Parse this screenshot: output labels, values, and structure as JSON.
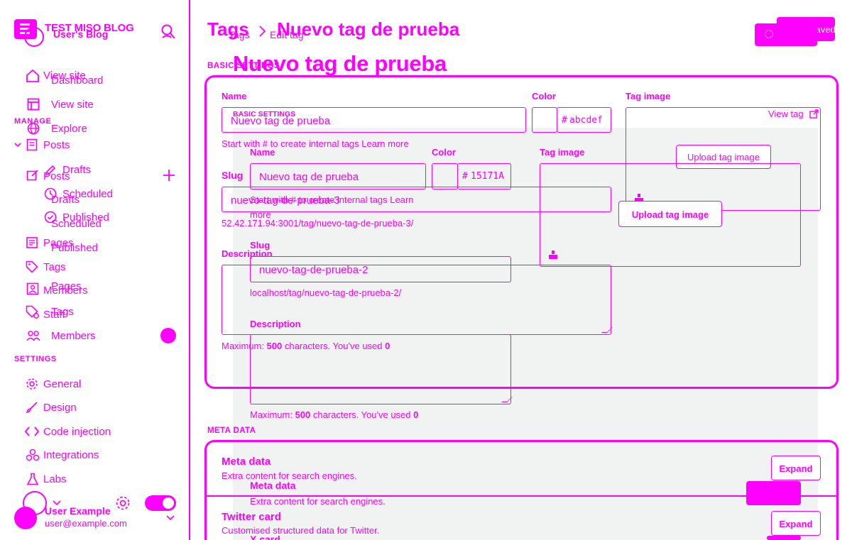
{
  "sidebar": {
    "blog_title": "TEST MISO BLOG",
    "user_blog": "User's Blog",
    "nav_top": {
      "view_site_a": "View site",
      "dashboard": "Dashboard",
      "view_site": "View site",
      "explore": "Explore"
    },
    "manage_label": "MANAGE",
    "posts": "Posts",
    "drafts_a": "Drafts",
    "posts_b": "Posts",
    "scheduled_a": "Scheduled",
    "drafts_b": "Drafts",
    "published_a": "Published",
    "scheduled_b": "Scheduled",
    "pages_a": "Pages",
    "published_b": "Published",
    "tags": "Tags",
    "pages_b": "Pages",
    "members_a": "Members",
    "staff": "Staff",
    "tags_b": "Tags",
    "members": "Members",
    "settings_label": "SETTINGS",
    "settings_items": [
      "General",
      "Design",
      "Code injection",
      "Integrations",
      "Labs"
    ],
    "user": {
      "name": "User Example",
      "email": "user@example.com"
    }
  },
  "header": {
    "crumb_parent": "Tags",
    "crumb_separator": ">",
    "crumb_current": "Nuevo tag de prueba",
    "crumb_small_parent": "Tags",
    "crumb_small_current": "Edit tag",
    "title": "Nuevo tag de prueba",
    "save_label": "Saved"
  },
  "basic_settings": {
    "section_label": "BASIC SETTINGS",
    "name_label": "Name",
    "name_value": "Nuevo tag de prueba",
    "color_label": "Color",
    "color_value": "abcdef",
    "color_hash": "#",
    "image_label": "Tag image",
    "view_tag": "View tag",
    "upload_label": "Upload tag image",
    "name_hint": "Start with # to create internal tags Learn more",
    "slug_label": "Slug",
    "slug_value": "nuevo-tag-de-prueba-3",
    "url_preview": "52.42.171.94:3001/tag/nuevo-tag-de-prueba-3/",
    "description_label": "Description",
    "max_hint_prefix": "Maximum: ",
    "max_count": "500",
    "max_hint_mid": " characters. You've used ",
    "used_count": "0"
  },
  "ghost_form": {
    "section_label": "BASIC SETTINGS",
    "name_label": "Name",
    "name_value": "Nuevo tag de prueba",
    "color_label": "Color",
    "color_hash": "#",
    "color_value": "15171A",
    "image_label": "Tag image",
    "upload_label": "Upload tag image",
    "name_hint_line1": "Start with # to create internal tags Learn",
    "name_hint_line2": "more",
    "slug_label": "Slug",
    "slug_value": "nuevo-tag-de-prueba-2",
    "url_preview": "localhost/tag/nuevo-tag-de-prueba-2/",
    "description_label": "Description",
    "max_hint_prefix": "Maximum: ",
    "max_count": "500",
    "max_hint_mid": " characters. You've used ",
    "used_count": "0"
  },
  "meta": {
    "section_label": "META DATA",
    "meta_title": "Meta data",
    "meta_desc": "Extra content for search engines.",
    "expand": "Expand",
    "ghost_meta_title": "Meta data",
    "ghost_meta_desc": "Extra content for search engines.",
    "twitter_title": "Twitter card",
    "twitter_desc": "Customised structured data for Twitter.",
    "x_card": "X card"
  }
}
